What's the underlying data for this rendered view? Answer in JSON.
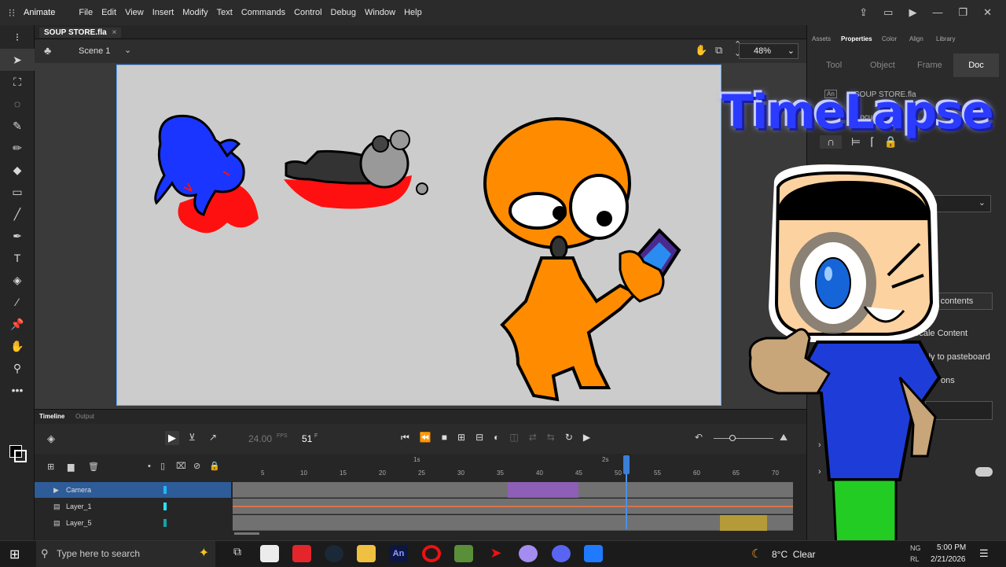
{
  "app": {
    "name": "Animate",
    "grid_icon": "app-grid-icon"
  },
  "menu": [
    "File",
    "Edit",
    "View",
    "Insert",
    "Modify",
    "Text",
    "Commands",
    "Control",
    "Debug",
    "Window",
    "Help"
  ],
  "document_tab": {
    "title": "SOUP STORE.fla",
    "close": "×"
  },
  "stage_bar": {
    "scene": "Scene 1",
    "zoom": "48%"
  },
  "panel_tabs": [
    "Assets",
    "Properties",
    "Color",
    "Align",
    "Library"
  ],
  "panel_active_tab": "Properties",
  "properties": {
    "subtabs": [
      "Tool",
      "Object",
      "Frame",
      "Doc"
    ],
    "active_subtab": "Doc",
    "doc_badge": "An",
    "doc_name": "SOUP STORE.fla",
    "doc_sub": "Docu",
    "match_contents": "ch contents",
    "scale_content": "Scale Content",
    "apply_pasteboard": "Apply to pasteboard",
    "options_fragment": "ons"
  },
  "overlay_text": "TimeLapse",
  "timeline": {
    "tabs": [
      "Timeline",
      "Output"
    ],
    "fps": "24.00",
    "fps_unit": "FPS",
    "frame": "51",
    "frame_unit": "F",
    "seconds_marks": [
      "1s",
      "2s"
    ],
    "frame_ticks": [
      "5",
      "10",
      "15",
      "20",
      "25",
      "30",
      "35",
      "40",
      "45",
      "50",
      "55",
      "60",
      "65",
      "70"
    ],
    "playhead_frame": 51,
    "layers": [
      {
        "name": "Camera",
        "selected": true,
        "color": "#1fb8ff"
      },
      {
        "name": "Layer_1",
        "selected": false,
        "color": "#29e3ff"
      },
      {
        "name": "Layer_5",
        "selected": false,
        "color": "#14a3a8"
      }
    ]
  },
  "taskbar": {
    "search_placeholder": "Type here to search",
    "weather": "8°C  Clear",
    "lang": "NG",
    "lang2": "RL",
    "time": "5:00 PM",
    "date": "2/21/2026"
  },
  "colors": {
    "accent": "#2e5c98",
    "stage": "#cccccc",
    "camera_tween": "#8e5fb6",
    "layer5_tween": "#b59a3a"
  }
}
